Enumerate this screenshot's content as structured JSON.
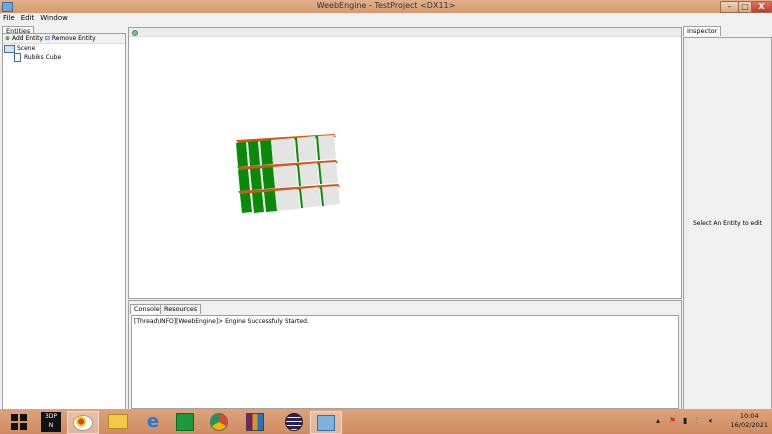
{
  "window": {
    "title": "WeebEngine - TestProject <DX11>",
    "minimize_label": "–",
    "maximize_label": "□",
    "close_label": "X"
  },
  "menu": {
    "items": [
      "File",
      "Edit",
      "Window"
    ]
  },
  "entities": {
    "tab_label": "Entities",
    "add_label": "Add Entity",
    "remove_label": "Remove Entity",
    "tree": {
      "root": "Scene",
      "children": [
        "Rubiks Cube"
      ]
    }
  },
  "console": {
    "tabs": [
      "Console",
      "Resources"
    ],
    "lines": [
      "[Thread\\INFO][WeebEngine]> Engine Successfuly Started."
    ]
  },
  "inspector": {
    "tab_label": "Inspector",
    "hint": "Select An Entity to edit"
  },
  "taskbar": {
    "clock_time": "10:04",
    "clock_date": "16/02/2021",
    "pinned": [
      "3DP-chip-icon",
      "paint-icon",
      "file-explorer-icon",
      "internet-explorer-icon",
      "store-icon",
      "chrome-icon",
      "winrar-icon",
      "eclipse-icon",
      "weebengine-icon"
    ]
  },
  "colors": {
    "cube_green": "#0a8a0a",
    "cube_white": "#e4e4e4",
    "cube_edge": "#c85a1c",
    "taskbar": "#d8996e"
  }
}
